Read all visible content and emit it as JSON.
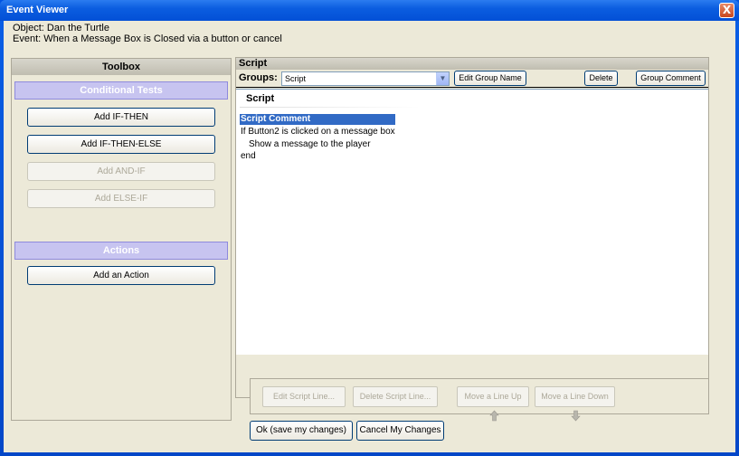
{
  "window": {
    "title": "Event Viewer",
    "close_glyph": "X"
  },
  "header": {
    "object_line": "Object: Dan the Turtle",
    "event_line": "Event: When a Message Box is Closed via a button or cancel"
  },
  "toolbox": {
    "title": "Toolbox",
    "conditional_section": "Conditional Tests",
    "buttons": {
      "add_if_then": "Add IF-THEN",
      "add_if_then_else": "Add IF-THEN-ELSE",
      "add_and_if": "Add AND-IF",
      "add_else_if": "Add ELSE-IF"
    },
    "actions_section": "Actions",
    "add_action": "Add an Action"
  },
  "script": {
    "panel_title": "Script",
    "groups_label": "Groups:",
    "groups_selected": "Script",
    "edit_group_name": "Edit Group Name",
    "delete": "Delete",
    "group_comment": "Group Comment",
    "area_title": "Script",
    "comment": "Script Comment",
    "lines": [
      "If Button2 is clicked on a message box",
      "Show a message to the player",
      "end"
    ]
  },
  "line_buttons": {
    "edit": "Edit Script Line...",
    "delete": "Delete Script Line...",
    "move_up": "Move a Line Up",
    "move_down": "Move a Line Down"
  },
  "footer": {
    "ok": "Ok (save my changes)",
    "cancel": "Cancel My Changes"
  },
  "colors": {
    "titlebar": "#0350d6",
    "section_bar": "#c7c4f0",
    "selection": "#316ac5",
    "dialog_bg": "#ece9d8"
  }
}
